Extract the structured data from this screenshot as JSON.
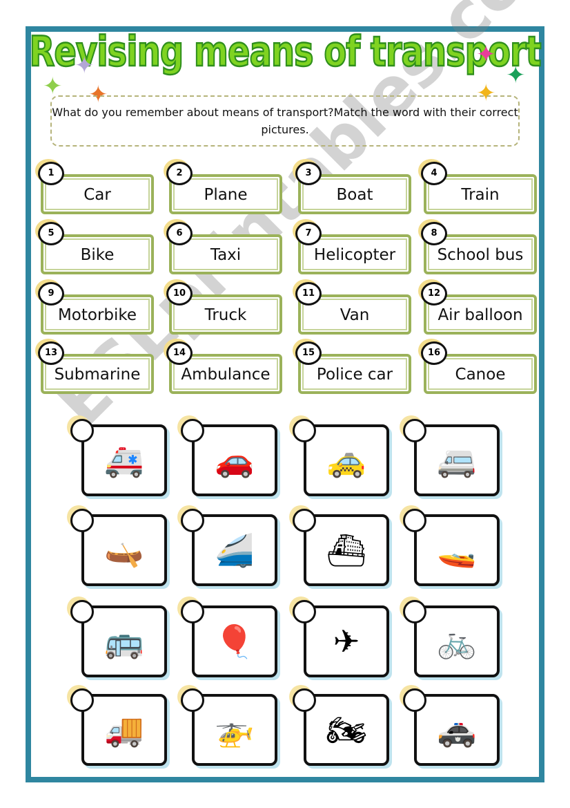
{
  "title": "Revising means of transport",
  "instructions": "What do you remember about means of transport?Match the word with their correct pictures.",
  "watermark": "ESLprintables.com",
  "words": [
    {
      "num": "1",
      "label": "Car"
    },
    {
      "num": "2",
      "label": "Plane"
    },
    {
      "num": "3",
      "label": "Boat"
    },
    {
      "num": "4",
      "label": "Train"
    },
    {
      "num": "5",
      "label": "Bike"
    },
    {
      "num": "6",
      "label": "Taxi"
    },
    {
      "num": "7",
      "label": "Helicopter"
    },
    {
      "num": "8",
      "label": "School bus"
    },
    {
      "num": "9",
      "label": "Motorbike"
    },
    {
      "num": "10",
      "label": "Truck"
    },
    {
      "num": "11",
      "label": "Van"
    },
    {
      "num": "12",
      "label": "Air balloon"
    },
    {
      "num": "13",
      "label": "Submarine"
    },
    {
      "num": "14",
      "label": "Ambulance"
    },
    {
      "num": "15",
      "label": "Police car"
    },
    {
      "num": "16",
      "label": "Canoe"
    }
  ],
  "pictures": [
    {
      "name": "ambulance",
      "glyph": "🚑"
    },
    {
      "name": "car",
      "glyph": "🚗"
    },
    {
      "name": "taxi",
      "glyph": "🚕"
    },
    {
      "name": "van",
      "glyph": "🚐"
    },
    {
      "name": "canoe",
      "glyph": "🛶"
    },
    {
      "name": "train",
      "glyph": "🚄"
    },
    {
      "name": "submarine",
      "glyph": "⛴"
    },
    {
      "name": "boat",
      "glyph": "🚤"
    },
    {
      "name": "school-bus",
      "glyph": "🚌"
    },
    {
      "name": "air-balloon",
      "glyph": "🎈"
    },
    {
      "name": "plane",
      "glyph": "✈"
    },
    {
      "name": "bike",
      "glyph": "🚲"
    },
    {
      "name": "truck",
      "glyph": "🚚"
    },
    {
      "name": "helicopter",
      "glyph": "🚁"
    },
    {
      "name": "motorbike",
      "glyph": "🏍"
    },
    {
      "name": "police-car",
      "glyph": "🚓"
    }
  ],
  "colors": {
    "border": "#2f86a0",
    "title": "#7fd321",
    "word_border": "#9bb25a"
  }
}
